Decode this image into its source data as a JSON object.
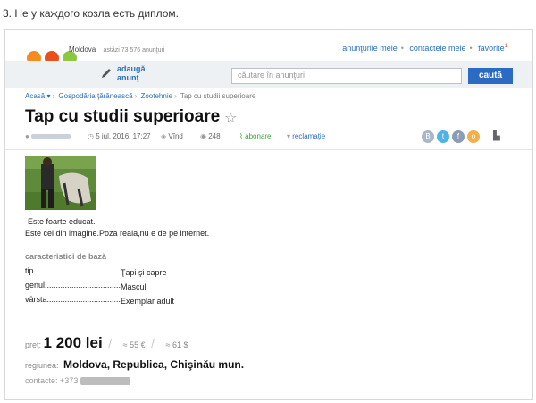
{
  "caption": "3. Не у каждого козла есть диплом.",
  "header": {
    "region": "Moldova",
    "ads_today": "astăzi 73 576 anunţuri",
    "links": [
      "anunţurile mele",
      "contactele mele",
      "favorite"
    ],
    "favorite_count": "1",
    "add_label_1": "adaugă",
    "add_label_2": "anunţ",
    "search_placeholder": "căutare în anunţuri",
    "search_button": "caută"
  },
  "breadcrumb": [
    "Acasă ▾",
    "Gospodăria ţărănească",
    "Zootehnie",
    "Tap cu studii superioare"
  ],
  "ad": {
    "title": "Tap cu studii superioare",
    "date": "5 iul. 2016, 17:27",
    "status": "Vînd",
    "views": "248",
    "subscribe": "abonare",
    "complaint": "reclamaţie",
    "description_line1": "Este foarte educat.",
    "description_line2": "Este cel din imagine.Poza reala,nu e de pe internet.",
    "characteristics_title": "caracteristici de bază",
    "characteristics": [
      {
        "key": "tip..........................................",
        "value": "Ţapi şi capre"
      },
      {
        "key": "genul........................................",
        "value": "Mascul"
      },
      {
        "key": "vârsta.......................................",
        "value": "Exemplar adult"
      }
    ],
    "price_label": "preţ:",
    "price": "1 200 lei",
    "price_eur": "≈ 55 €",
    "price_usd": "≈ 61 $",
    "region_label": "regiunea:",
    "region": "Moldova, Republica, Chişinău mun.",
    "contacts_label": "contacte:",
    "phone_prefix": "+373"
  },
  "colors": {
    "accent": "#2b6bc4",
    "logo_orange": "#f28c1e",
    "logo_green": "#8dc63f"
  }
}
